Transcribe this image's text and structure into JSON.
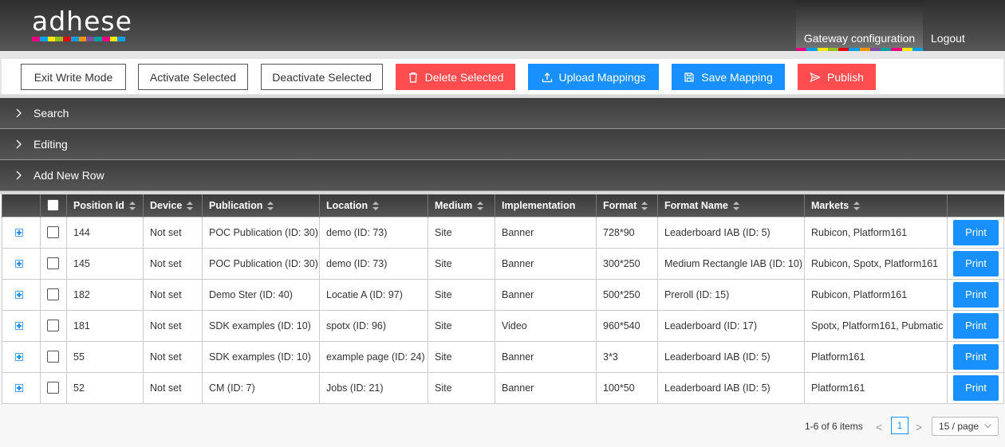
{
  "brand": {
    "logo_text": "adhese",
    "strip_colors": [
      "#e6007e",
      "#00a0e3",
      "#ffe600",
      "#95c11f",
      "#e30613",
      "#009fe3",
      "#f39200",
      "#7d4e9e",
      "#00a19a",
      "#e6007e",
      "#ffe600",
      "#00a0e3"
    ]
  },
  "nav": {
    "active": "Gateway configuration",
    "logout": "Logout"
  },
  "toolbar": {
    "exit_write_mode": "Exit Write Mode",
    "activate_selected": "Activate Selected",
    "deactivate_selected": "Deactivate Selected",
    "delete_selected": "Delete Selected",
    "upload_mappings": "Upload Mappings",
    "save_mapping": "Save Mapping",
    "publish": "Publish"
  },
  "panels": [
    "Search",
    "Editing",
    "Add New Row"
  ],
  "table": {
    "columns": [
      "Position Id",
      "Device",
      "Publication",
      "Location",
      "Medium",
      "Implementation",
      "Format",
      "Format Name",
      "Markets"
    ],
    "print_label": "Print",
    "rows": [
      [
        "144",
        "Not set",
        "POC Publication (ID: 30)",
        "demo (ID: 73)",
        "Site",
        "Banner",
        "728*90",
        "Leaderboard IAB (ID: 5)",
        "Rubicon, Platform161"
      ],
      [
        "145",
        "Not set",
        "POC Publication (ID: 30)",
        "demo (ID: 73)",
        "Site",
        "Banner",
        "300*250",
        "Medium Rectangle IAB (ID: 10)",
        "Rubicon, Spotx, Platform161"
      ],
      [
        "182",
        "Not set",
        "Demo Ster (ID: 40)",
        "Locatie A (ID: 97)",
        "Site",
        "Banner",
        "500*250",
        "Preroll (ID: 15)",
        "Rubicon, Platform161"
      ],
      [
        "181",
        "Not set",
        "SDK examples (ID: 10)",
        "spotx (ID: 96)",
        "Site",
        "Video",
        "960*540",
        "Leaderboard (ID: 17)",
        "Spotx, Platform161, Pubmatic"
      ],
      [
        "55",
        "Not set",
        "SDK examples (ID: 10)",
        "example page (ID: 24)",
        "Site",
        "Banner",
        "3*3",
        "Leaderboard IAB (ID: 5)",
        "Platform161"
      ],
      [
        "52",
        "Not set",
        "CM (ID: 7)",
        "Jobs (ID: 21)",
        "Site",
        "Banner",
        "100*50",
        "Leaderboard IAB (ID: 5)",
        "Platform161"
      ]
    ]
  },
  "pagination": {
    "total": "1-6 of 6 items",
    "current_page": "1",
    "page_size": "15 / page",
    "prev": "<",
    "next": ">"
  },
  "colors": {
    "accent_blue": "#1890ff",
    "danger_red": "#ff4d4f",
    "header_dark": "#3a3a3a"
  }
}
